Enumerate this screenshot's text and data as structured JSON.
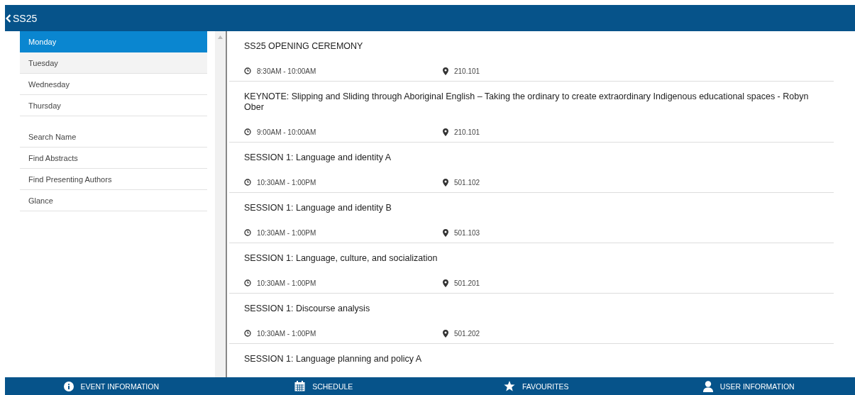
{
  "header": {
    "back_title": "SS25"
  },
  "days": [
    {
      "label": "Monday",
      "selected": true,
      "hovered": false
    },
    {
      "label": "Tuesday",
      "selected": false,
      "hovered": true
    },
    {
      "label": "Wednesday",
      "selected": false,
      "hovered": false
    },
    {
      "label": "Thursday",
      "selected": false,
      "hovered": false
    }
  ],
  "tools": [
    {
      "label": "Search Name"
    },
    {
      "label": "Find Abstracts"
    },
    {
      "label": "Find Presenting Authors"
    },
    {
      "label": "Glance"
    }
  ],
  "sessions": [
    {
      "title": "SS25 OPENING CEREMONY",
      "time": "8:30AM - 10:00AM",
      "room": "210.101"
    },
    {
      "title": "KEYNOTE: Slipping and Sliding through Aboriginal English – Taking the ordinary to create extraordinary Indigenous educational spaces - Robyn Ober",
      "time": "9:00AM - 10:00AM",
      "room": "210.101"
    },
    {
      "title": "SESSION 1: Language and identity A",
      "time": "10:30AM - 1:00PM",
      "room": "501.102"
    },
    {
      "title": "SESSION 1: Language and identity B",
      "time": "10:30AM - 1:00PM",
      "room": "501.103"
    },
    {
      "title": "SESSION 1: Language, culture, and socialization",
      "time": "10:30AM - 1:00PM",
      "room": "501.201"
    },
    {
      "title": "SESSION 1: Discourse analysis",
      "time": "10:30AM - 1:00PM",
      "room": "501.202"
    },
    {
      "title": "SESSION 1: Language planning and policy A"
    }
  ],
  "bottom_nav": [
    {
      "kind": "info",
      "label": "EVENT INFORMATION"
    },
    {
      "kind": "calendar",
      "label": "SCHEDULE"
    },
    {
      "kind": "star",
      "label": "FAVOURITES"
    },
    {
      "kind": "user",
      "label": "USER INFORMATION"
    }
  ]
}
